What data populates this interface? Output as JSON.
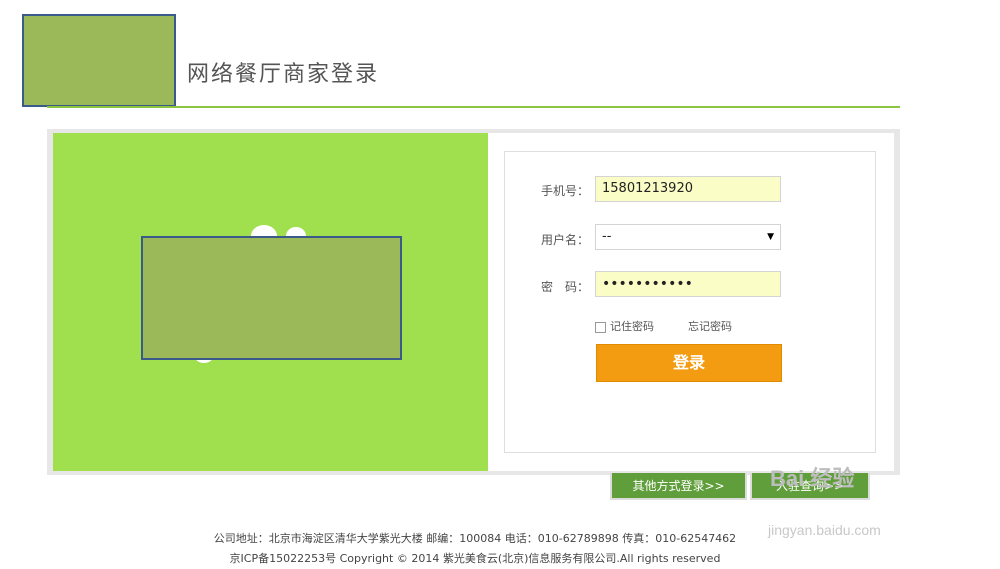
{
  "header": {
    "title": "网络餐厅商家登录"
  },
  "form": {
    "phone_label": "手机号：",
    "phone_value": "15801213920",
    "username_label": "用户名：",
    "username_value": "--",
    "password_label": "密　码：",
    "password_value": "•••••••••••",
    "remember_label": "记住密码",
    "forgot_label": "忘记密码",
    "login_label": "登录"
  },
  "tabs": {
    "other_login": "其他方式登录>>",
    "join_query": "入驻查询>>"
  },
  "footer": {
    "address_line": "公司地址：北京市海淀区清华大学紫光大楼 邮编：100084 电话：010-62789898 传真：010-62547462",
    "copyright_line": "京ICP备15022253号 Copyright © 2014 紫光美食云(北京)信息服务有限公司.All rights reserved"
  },
  "watermark": {
    "main": "Bai 经验",
    "sub": "jingyan.baidu.com"
  },
  "colors": {
    "accent_green": "#8cc63e",
    "panel_green": "#a0e04e",
    "login_orange": "#f39c12",
    "tab_green": "#5f9e3a"
  }
}
